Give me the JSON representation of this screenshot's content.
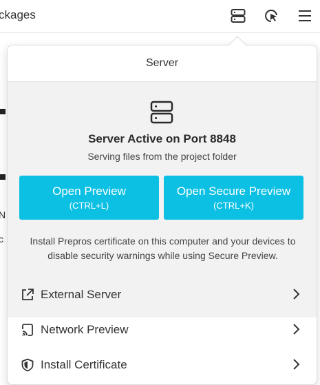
{
  "topbar": {
    "crumb": "ckages",
    "icons": [
      "server-icon",
      "live-reload-icon",
      "hamburger-menu-icon"
    ]
  },
  "background": {
    "fragment_n": "N",
    "fragment_c": "c"
  },
  "popover": {
    "title": "Server",
    "status_title": "Server Active on Port 8848",
    "status_subtitle": "Serving files from the project folder",
    "open_preview": {
      "label": "Open Preview",
      "shortcut": "(CTRL+L)"
    },
    "open_secure_preview": {
      "label": "Open Secure Preview",
      "shortcut": "(CTRL+K)"
    },
    "note": "Install Prepros certificate on this computer and your devices to disable security warnings while using Secure Preview.",
    "menu": [
      {
        "label": "External Server",
        "icon": "external-link-icon"
      },
      {
        "label": "Network Preview",
        "icon": "cast-icon"
      },
      {
        "label": "Install Certificate",
        "icon": "shield-icon"
      }
    ]
  },
  "colors": {
    "accent": "#0cc0e4",
    "panel_bg": "#f2f2f2"
  }
}
